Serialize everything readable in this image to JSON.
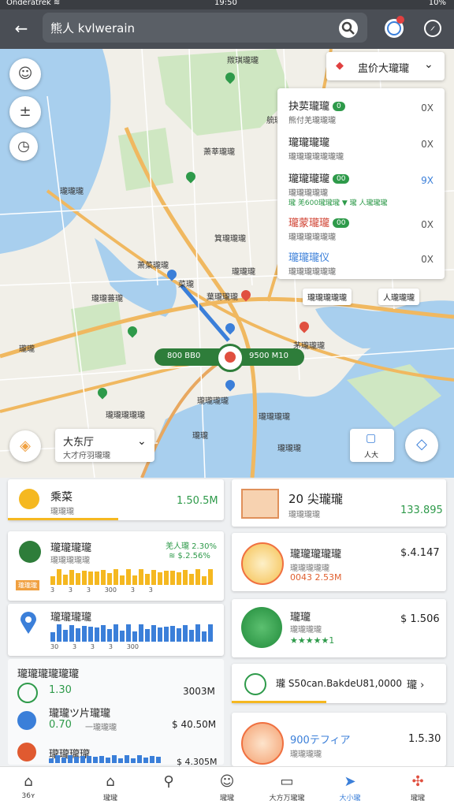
{
  "status": {
    "left": "Onderatrek ≋",
    "time": "19:50",
    "right": "10%"
  },
  "header": {
    "title": "熊人 kvlwerain"
  },
  "icons": {
    "back": "arrow-left-icon",
    "search": "search-icon",
    "profile": "profile-icon",
    "settings": "compass-icon"
  },
  "map_labels": [
    "羰琪瓏瓏",
    "艈瓏瓏",
    "萧莘瓏瓏",
    "瓏瓏瓏",
    "箕瓏瓏瓏",
    "萧菜瓏瓏",
    "瓏瓏瓏",
    "菜瓏",
    "瓏瓏蕃瓏",
    "葉瓏瓏瓏",
    "瓏瓏",
    "瓏瓏",
    "ʀ瓏瓏瓏",
    "瓏瓏",
    "茅瓏瓏瓏",
    "瓏瓏",
    "瓏瓏瓏瓏",
    "瓏瓏瓏瓏瓏",
    "瓏瓏瓏瓏",
    "瓏瓏瓏",
    "瓏瓏",
    "瓏瓏"
  ],
  "route_chip": {
    "left": "800 BB0",
    "right": "9500 M10"
  },
  "layers": {
    "button": "盅价大瓏瓏",
    "items": [
      {
        "title": "抉荬瓏瓏",
        "badge": "0",
        "sub": "熊付羌瓏瓏瓏",
        "close": "0X"
      },
      {
        "title": "瓏瓏瓏瓏",
        "badge": "",
        "sub": "瓏瓏瓏瓏瓏瓏瓏",
        "close": "0X"
      },
      {
        "title": "瓏瓏瓏瓏",
        "badge": "00",
        "sub": "瓏瓏瓏瓏瓏",
        "close": "9X",
        "extra": "瓏 羌600瓏瓏瓏 ▼ 瓏 人瓏瓏瓏"
      },
      {
        "title": "瓏蒙瓏瓏",
        "badge": "00",
        "sub": "瓏瓏瓏瓏瓏瓏",
        "close": "0X"
      },
      {
        "title": "瓏瓏瓏仪",
        "badge": "",
        "sub": "瓏瓏瓏瓏瓏瓏",
        "close": "0X"
      }
    ],
    "chips": [
      "瓏瓏瓏瓏瓏",
      "人瓏瓏瓏"
    ]
  },
  "dropdown": {
    "title": "大东厅",
    "sub": "大才疛羽瓏瓏"
  },
  "map_side": {
    "label": "人大"
  },
  "cards": {
    "c1": {
      "title": "乘菜",
      "sub": "瓏瓏瓏",
      "value": "1.50.5M"
    },
    "c2": {
      "title": "20 尖瓏瓏",
      "sub": "瓏瓏瓏瓏",
      "value": "133.895"
    },
    "c3": {
      "title": "瓏瓏瓏瓏",
      "sub": "瓏瓏瓏瓏瓏",
      "v1": "羌人瓏 2.30%",
      "v2": "≋ $.2.56%",
      "axis": "瓏瓏瓏",
      "ticks": [
        "3",
        "3",
        "3",
        "300",
        "3",
        "3",
        "3"
      ]
    },
    "c4": {
      "title": "瓏瓏瓏瓏瓏",
      "sub": "瓏瓏瓏瓏瓏",
      "value": "$.4.147",
      "v2": "0043 2.53M"
    },
    "c5": {
      "title": "瓏瓏瓏瓏",
      "ticks": [
        "30",
        "3",
        "3",
        "3",
        "300",
        "3",
        "3"
      ]
    },
    "c6": {
      "title": "瓏瓏",
      "sub": "瓏瓏瓏瓏",
      "value": "$ 1.506",
      "stars": "★★★★★1"
    },
    "c7": {
      "title": "瓏瓏瓏瓏瓏瓏",
      "r1": "1.30",
      "r1v": "3003M",
      "r2t": "瓏瓏ツ片瓏瓏",
      "r2": "0.70",
      "r2s": "一瓏瓏瓏",
      "r2v": "$ 40.50M",
      "r3t": "瓏瓏瓏瓏",
      "r3v": "$ 4.305M"
    },
    "c8": {
      "title": "瓏 S50can.BakdeU81,0000",
      "arrow": "瓏 ›"
    },
    "c9": {
      "title": "900テフィア",
      "sub": "瓏瓏瓏瓏",
      "value": "1.5.30"
    }
  },
  "nav": [
    {
      "label": "36ʏ",
      "icon": "home-icon"
    },
    {
      "label": "瓏瓏",
      "icon": "house-icon"
    },
    {
      "label": "",
      "icon": "search-pin-icon"
    },
    {
      "label": "瓏瓏",
      "icon": "smile-icon"
    },
    {
      "label": "大方万瓏瓏",
      "icon": "card-icon"
    },
    {
      "label": "大小瓏",
      "icon": "route-icon"
    },
    {
      "label": "瓏瓏",
      "icon": "game-icon"
    }
  ],
  "colors": {
    "accent": "#2e9a4a",
    "blue": "#3b7fd9",
    "orange": "#f0b030",
    "red": "#e05040"
  }
}
